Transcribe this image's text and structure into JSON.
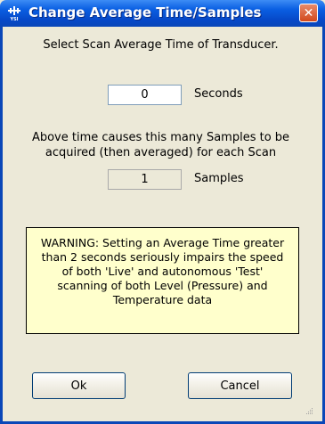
{
  "window": {
    "title": "Change Average Time/Samples",
    "app_icon": "ysi-logo-icon",
    "close_icon": "close-icon",
    "close_glyph": "✕"
  },
  "content": {
    "prompt": "Select Scan Average Time of Transducer.",
    "time_value": "0",
    "time_unit": "Seconds",
    "explain_line1": "Above time causes this many Samples to be",
    "explain_line2": "acquired (then averaged) for each Scan",
    "samples_value": "1",
    "samples_unit": "Samples",
    "warning_line1": "WARNING: Setting an Average Time greater",
    "warning_line2": "than 2 seconds seriously impairs the speed",
    "warning_line3": "of both 'Live' and autonomous 'Test'",
    "warning_line4": "scanning of both Level (Pressure) and",
    "warning_line5": "Temperature data"
  },
  "buttons": {
    "ok": "Ok",
    "cancel": "Cancel"
  },
  "colors": {
    "titlebar": "#0A5FE2",
    "dialog_bg": "#ECE9D8",
    "warning_bg": "#FFFFCC",
    "close_bg": "#D2491C"
  }
}
